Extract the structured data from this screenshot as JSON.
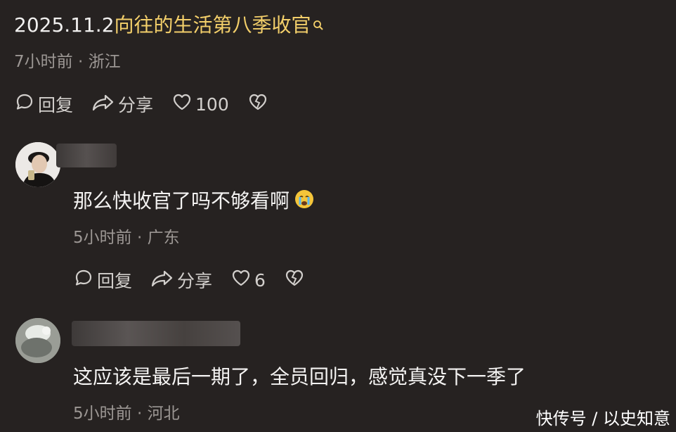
{
  "post": {
    "date_prefix": "2025.11.2",
    "title_link": "向往的生活第八季收官",
    "meta": "7小时前 · 浙江",
    "reply_label": "回复",
    "share_label": "分享",
    "like_count": "100"
  },
  "comments": [
    {
      "text": "那么快收官了吗不够看啊",
      "meta": "5小时前 · 广东",
      "reply_label": "回复",
      "share_label": "分享",
      "like_count": "6"
    },
    {
      "text": "这应该是最后一期了，全员回归，感觉真没下一季了",
      "meta": "5小时前 · 河北"
    }
  ],
  "watermark": "快传号 / 以史知意",
  "colors": {
    "background": "#262221",
    "link": "#f3cf6a",
    "meta": "#9c9794"
  }
}
